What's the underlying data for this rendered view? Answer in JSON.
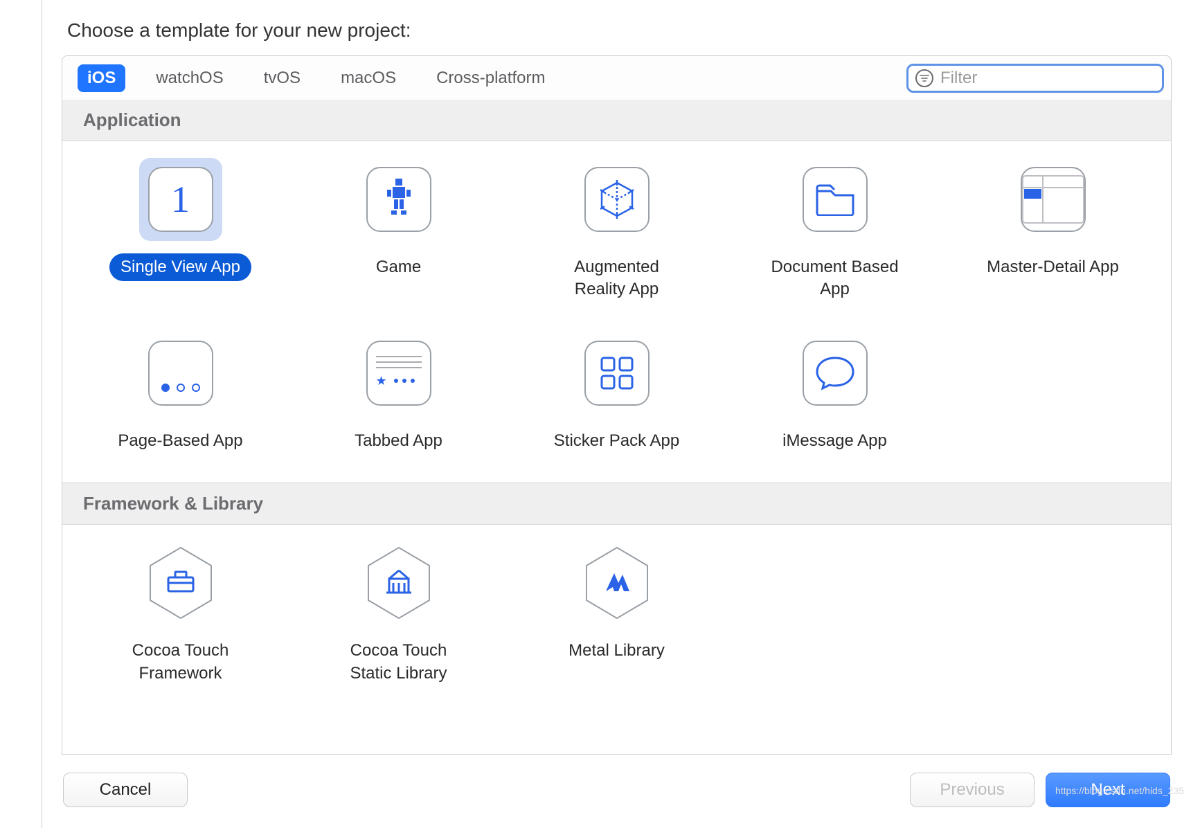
{
  "prompt": "Choose a template for your new project:",
  "tabs": [
    "iOS",
    "watchOS",
    "tvOS",
    "macOS",
    "Cross-platform"
  ],
  "active_tab": "iOS",
  "filter": {
    "placeholder": "Filter",
    "value": ""
  },
  "sections": [
    {
      "title": "Application",
      "items": [
        {
          "label": "Single View App",
          "icon": "single-view",
          "selected": true
        },
        {
          "label": "Game",
          "icon": "game"
        },
        {
          "label": "Augmented Reality App",
          "icon": "ar"
        },
        {
          "label": "Document Based App",
          "icon": "document"
        },
        {
          "label": "Master-Detail App",
          "icon": "master-detail"
        },
        {
          "label": "Page-Based App",
          "icon": "page-based"
        },
        {
          "label": "Tabbed App",
          "icon": "tabbed"
        },
        {
          "label": "Sticker Pack App",
          "icon": "sticker"
        },
        {
          "label": "iMessage App",
          "icon": "imessage"
        }
      ]
    },
    {
      "title": "Framework & Library",
      "items": [
        {
          "label": "Cocoa Touch Framework",
          "icon": "framework"
        },
        {
          "label": "Cocoa Touch Static Library",
          "icon": "static-lib"
        },
        {
          "label": "Metal Library",
          "icon": "metal"
        }
      ]
    }
  ],
  "buttons": {
    "cancel": "Cancel",
    "previous": "Previous",
    "next": "Next"
  },
  "watermark": "https://blog.csdn.net/hids_235"
}
